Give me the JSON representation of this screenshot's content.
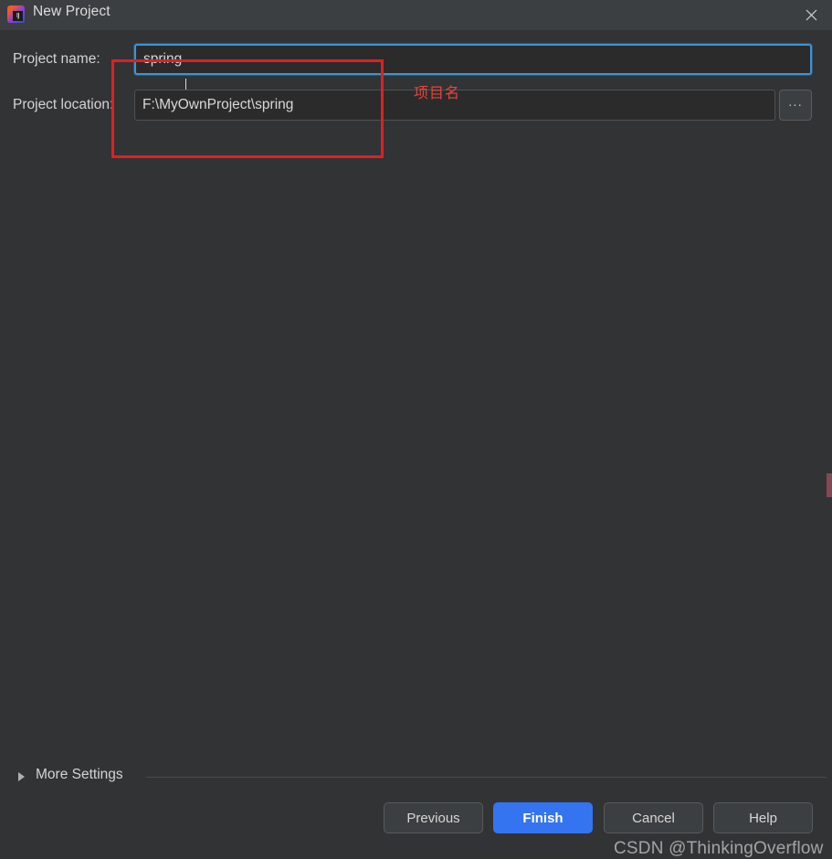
{
  "window": {
    "title": "New Project",
    "app_icon": "intellij-idea-icon",
    "icon_badge": "IJ",
    "close_icon": "close-icon"
  },
  "form": {
    "fields": [
      {
        "label": "Project name:",
        "value": "spring",
        "focused": true,
        "has_browse": false
      },
      {
        "label": "Project location:",
        "value": "F:\\MyOwnProject\\spring",
        "focused": false,
        "has_browse": true,
        "browse_label": "..."
      }
    ]
  },
  "annotation": {
    "text": "项目名",
    "box_color": "#e02020",
    "text_color": "#e8453c"
  },
  "more_settings": {
    "label": "More Settings",
    "expanded": false,
    "disclosure_icon": "triangle-right-icon"
  },
  "footer": {
    "buttons": [
      {
        "label": "Previous",
        "primary": false
      },
      {
        "label": "Finish",
        "primary": true
      },
      {
        "label": "Cancel",
        "primary": false
      },
      {
        "label": "Help",
        "primary": false
      }
    ]
  },
  "watermark": {
    "text": "CSDN @ThinkingOverflow"
  },
  "colors": {
    "dialog_background": "#313335",
    "titlebar_background": "#3c3f41",
    "input_background": "#2b2b2b",
    "focus_border": "#3d93d4",
    "primary_button": "#3574f0",
    "text": "#d6d6d6"
  }
}
